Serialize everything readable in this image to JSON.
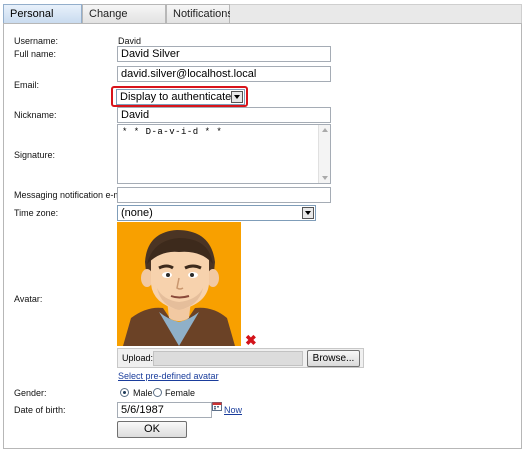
{
  "tabs": [
    {
      "label": "Personal settings",
      "active": true
    },
    {
      "label": "Change password",
      "active": false
    },
    {
      "label": "Notifications",
      "active": false
    }
  ],
  "form": {
    "username": {
      "label": "Username:",
      "value": "David"
    },
    "full_name": {
      "label": "Full name:",
      "value": "David Silver"
    },
    "email": {
      "label": "Email:",
      "value": "david.silver@localhost.local",
      "visibility": "Display to authenticated"
    },
    "nickname": {
      "label": "Nickname:",
      "value": "David"
    },
    "signature": {
      "label": "Signature:",
      "value": "* * D-a-v-i-d * *"
    },
    "messaging_email": {
      "label": "Messaging notification e-mail:",
      "value": ""
    },
    "time_zone": {
      "label": "Time zone:",
      "value": "(none)"
    },
    "avatar": {
      "label": "Avatar:",
      "upload_label": "Upload:",
      "browse_label": "Browse...",
      "predefined_link": "Select pre-defined avatar",
      "remove_icon": "remove-x-icon"
    },
    "gender": {
      "label": "Gender:",
      "options": [
        "Male",
        "Female"
      ],
      "selected": "Male"
    },
    "date_of_birth": {
      "label": "Date of birth:",
      "value": "5/6/1987",
      "now_link": "Now",
      "calendar_icon": "calendar-icon"
    },
    "ok_label": "OK"
  },
  "colors": {
    "highlight": "#d8141b",
    "avatar_bg": "#f8a000",
    "link": "#1a3d9c",
    "active_tab": "#c9dbef"
  }
}
